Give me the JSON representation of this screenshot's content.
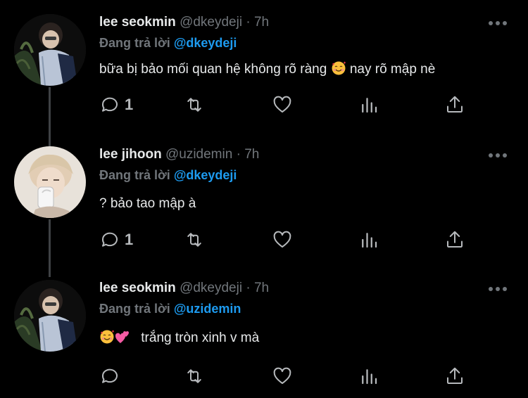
{
  "thread": [
    {
      "name": "lee seokmin",
      "handle": "@dkeydeji",
      "separator": "·",
      "time": "7h",
      "reply_label": "Đang trả lời",
      "reply_to": "@dkeydeji",
      "text_before": "bữa bị bảo mối quan hệ không rõ ràng",
      "text_after": "nay rõ mập nè",
      "emoji": "smiling-face-with-hearts",
      "replies": "1"
    },
    {
      "name": "lee jihoon",
      "handle": "@uzidemin",
      "separator": "·",
      "time": "7h",
      "reply_label": "Đang trả lời",
      "reply_to": "@dkeydeji",
      "text": "? bảo tao mập à",
      "replies": "1"
    },
    {
      "name": "lee seokmin",
      "handle": "@dkeydeji",
      "separator": "·",
      "time": "7h",
      "reply_label": "Đang trả lời",
      "reply_to": "@uzidemin",
      "emojis": [
        "smiling-face-with-hearts",
        "two-hearts"
      ],
      "text": "trắng tròn xinh v mà",
      "replies": ""
    }
  ],
  "colors": {
    "background": "#000000",
    "text": "#e7e9ea",
    "muted": "#71767b",
    "mention": "#1d9bf0",
    "thread_line": "#3e4144"
  }
}
